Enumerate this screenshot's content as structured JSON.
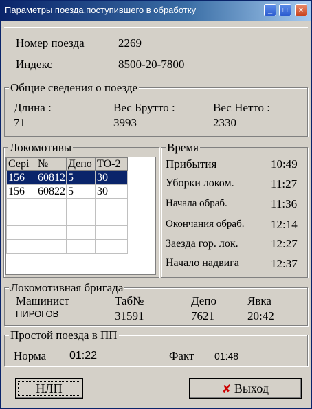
{
  "window": {
    "title": "Параметры поезда,поступившего в обработку",
    "min_glyph": "_",
    "max_glyph": "□",
    "close_glyph": "×"
  },
  "train": {
    "number_label": "Номер поезда",
    "number_value": "2269",
    "index_label": "Индекс",
    "index_value": "8500-20-7800"
  },
  "general": {
    "legend": "Общие сведения о поезде",
    "length_label": "Длина :",
    "length_value": "71",
    "gross_label": "Вес Брутто :",
    "gross_value": "3993",
    "net_label": "Вес Нетто :",
    "net_value": "2330"
  },
  "locomotives": {
    "legend": "Локомотивы",
    "columns": [
      "Сері",
      "№",
      "Депо",
      "ТО-2"
    ],
    "rows": [
      [
        "156",
        "60812",
        "5",
        "30"
      ],
      [
        "156",
        "60822",
        "5",
        "30"
      ]
    ]
  },
  "time": {
    "legend": "Время",
    "items": [
      {
        "label": "Прибытия",
        "value": "10:49"
      },
      {
        "label": "Уборки локом.",
        "value": "11:27"
      },
      {
        "label": "Начала обраб.",
        "value": "11:36"
      },
      {
        "label": "Окончания обраб.",
        "value": "12:14"
      },
      {
        "label": "Заезда гор. лок.",
        "value": "12:27"
      },
      {
        "label": "Начало надвига",
        "value": "12:37"
      }
    ]
  },
  "crew": {
    "legend": "Локомотивная бригада",
    "driver_label": "Машинист",
    "driver_value": "ПИРОГОВ",
    "tab_label": "Таб№",
    "tab_value": "31591",
    "depot_label": "Депо",
    "depot_value": "7621",
    "report_label": "Явка",
    "report_value": "20:42"
  },
  "idle": {
    "legend": "Простой поезда в ПП",
    "norm_label": "Норма",
    "norm_value": "01:22",
    "fact_label": "Факт",
    "fact_value": "01:48"
  },
  "buttons": {
    "nlp_label": "НЛП",
    "exit_label": "Выход",
    "exit_icon": "✘",
    "exit_icon_color": "#cc0000"
  }
}
